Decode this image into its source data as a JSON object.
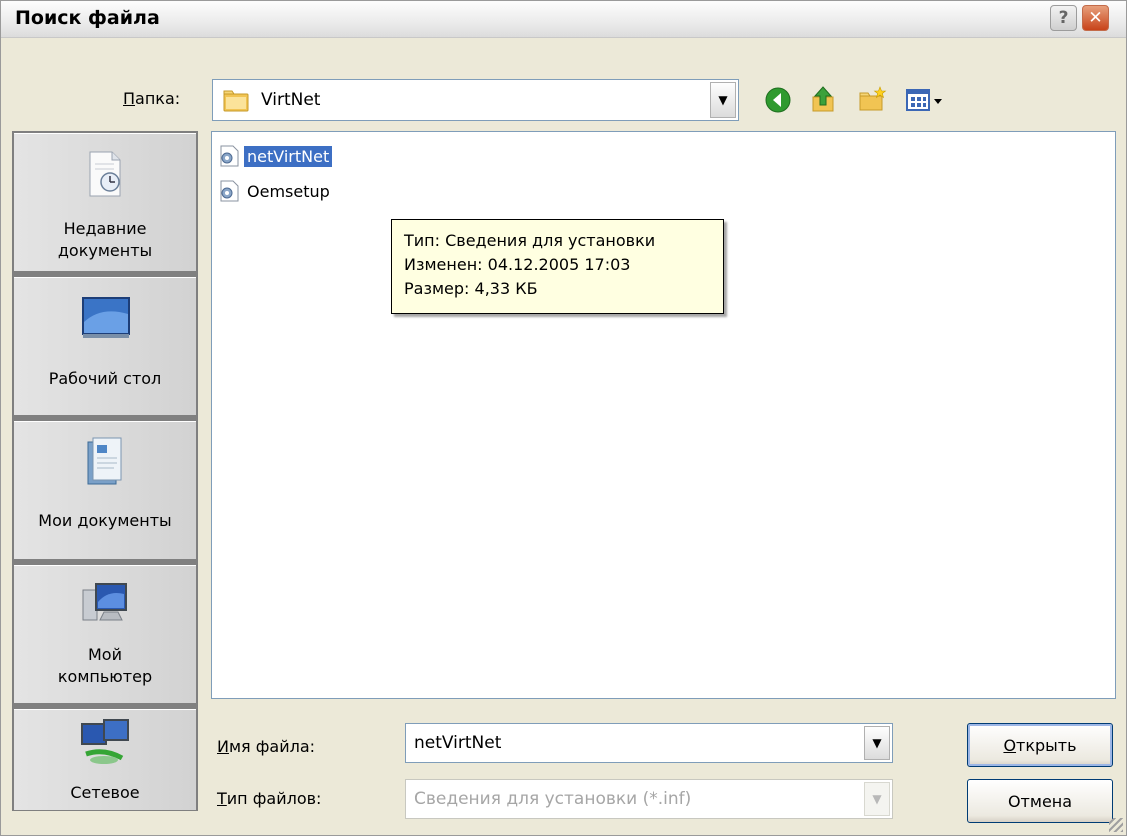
{
  "window": {
    "title": "Поиск файла",
    "help_glyph": "?",
    "close_glyph": "✕"
  },
  "location": {
    "label": "Папка:",
    "label_accel": "П",
    "label_rest": "апка:",
    "value": "VirtNet"
  },
  "toolbar": {
    "icons": [
      "back-icon",
      "up-folder-icon",
      "new-folder-icon",
      "view-menu-icon"
    ]
  },
  "places": [
    {
      "line1": "Недавние",
      "line2": "документы",
      "icon": "recent-documents-icon"
    },
    {
      "line1": "Рабочий стол",
      "line2": "",
      "icon": "desktop-icon"
    },
    {
      "line1": "Мои документы",
      "line2": "",
      "icon": "my-documents-icon"
    },
    {
      "line1": "Мой",
      "line2": "компьютер",
      "icon": "my-computer-icon"
    },
    {
      "line1": "Сетевое",
      "line2": "",
      "icon": "network-icon"
    }
  ],
  "files": [
    {
      "name": "netVirtNet",
      "selected": true,
      "icon": "inf-file-icon"
    },
    {
      "name": "Oemsetup",
      "selected": false,
      "icon": "inf-file-icon"
    }
  ],
  "tooltip": {
    "type": "Тип: Сведения для установки",
    "modified": "Изменен: 04.12.2005 17:03",
    "size": "Размер: 4,33 КБ"
  },
  "filename": {
    "label_accel": "И",
    "label_rest": "мя файла:",
    "value": "netVirtNet"
  },
  "filetype": {
    "label_accel": "Т",
    "label_rest": "ип файлов:",
    "value": "Сведения для установки (*.inf)"
  },
  "buttons": {
    "open_accel": "О",
    "open_rest": "ткрыть",
    "cancel": "Отмена"
  },
  "colors": {
    "selection": "#3d6fc4",
    "tooltip_bg": "#ffffe1",
    "dialog_bg": "#ece9d8"
  }
}
